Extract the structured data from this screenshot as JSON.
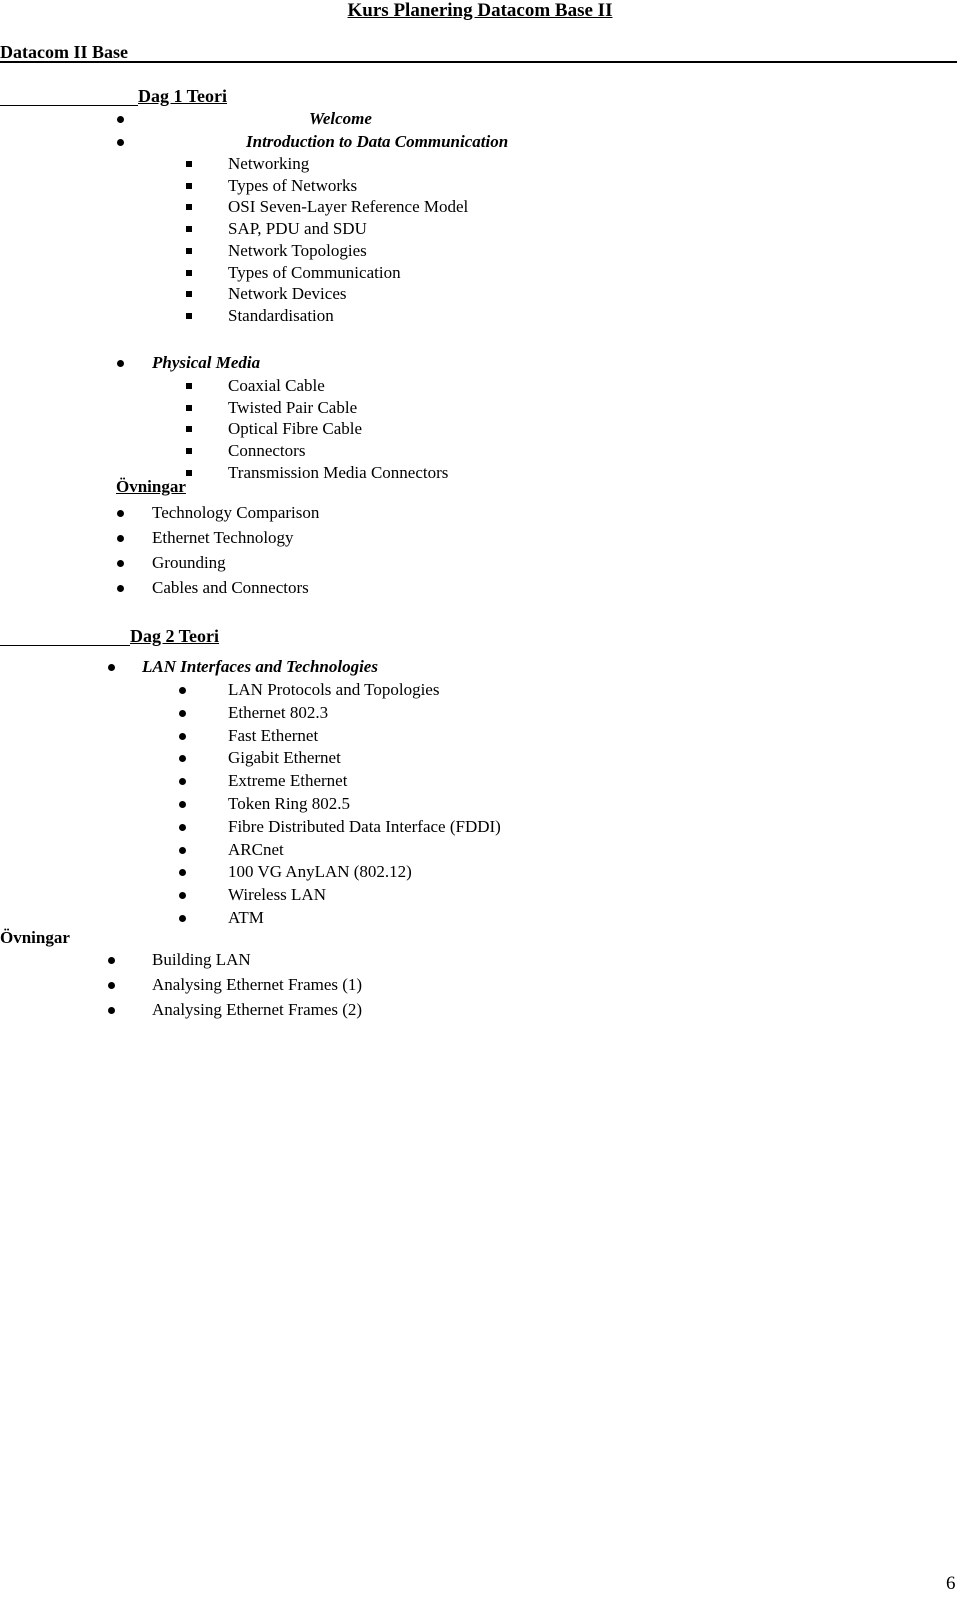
{
  "document_title": "Kurs Planering Datacom Base II",
  "course_name": "Datacom II Base",
  "day1": {
    "heading": "Dag 1 Teori",
    "topics": [
      {
        "label": "Welcome",
        "subitems": []
      },
      {
        "label": "Introduction to Data Communication",
        "subitems": [
          "Networking",
          "Types of Networks",
          "OSI Seven-Layer Reference Model",
          "SAP, PDU and SDU",
          "Network Topologies",
          "Types of Communication",
          "Network Devices",
          "Standardisation"
        ]
      },
      {
        "label": "Physical Media",
        "subitems": [
          "Coaxial Cable",
          "Twisted Pair Cable",
          "Optical Fibre Cable",
          "Connectors",
          "Transmission Media Connectors"
        ]
      }
    ],
    "exercises_heading": "Övningar",
    "exercises": [
      "Technology Comparison",
      "Ethernet Technology",
      "Grounding",
      "Cables and Connectors"
    ]
  },
  "day2": {
    "heading": "Dag 2 Teori",
    "topic": "LAN Interfaces and Technologies",
    "subitems": [
      "LAN Protocols and Topologies",
      "Ethernet 802.3",
      "Fast Ethernet",
      "Gigabit Ethernet",
      "Extreme Ethernet",
      "Token Ring 802.5",
      "Fibre Distributed Data Interface (FDDI)",
      "ARCnet",
      "100 VG AnyLAN (802.12)",
      "Wireless LAN",
      "ATM"
    ],
    "exercises_heading": "Övningar",
    "exercises": [
      "Building LAN",
      "Analysing Ethernet Frames (1)",
      "Analysing Ethernet Frames (2)"
    ]
  },
  "page_number": "6"
}
